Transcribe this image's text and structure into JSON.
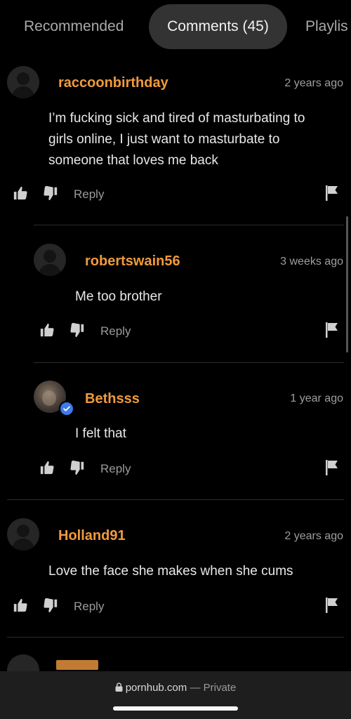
{
  "tabs": [
    {
      "label": "Recommended",
      "active": false
    },
    {
      "label": "Comments (45)",
      "active": true
    },
    {
      "label": "Playlis",
      "active": false
    }
  ],
  "actions": {
    "reply_label": "Reply"
  },
  "comments": [
    {
      "username": "raccoonbirthday",
      "time": "2 years ago",
      "body": "I’m fucking sick and tired of masturbating to girls online, I just want to masturbate to someone that loves me back",
      "avatar": "default-avatar-icon",
      "verified": false
    },
    {
      "username": "robertswain56",
      "time": "3 weeks ago",
      "body": "Me too brother",
      "avatar": "default-avatar-icon",
      "verified": false
    },
    {
      "username": "Bethsss",
      "time": "1 year ago",
      "body": "I felt that",
      "avatar": "profile-photo",
      "verified": true
    },
    {
      "username": "Holland91",
      "time": "2 years ago",
      "body": "Love the face she makes when she cums",
      "avatar": "default-avatar-icon",
      "verified": false
    }
  ],
  "browser": {
    "domain": "pornhub.com",
    "separator": "—",
    "mode": "Private"
  },
  "colors": {
    "background": "#000000",
    "username": "#f19a3e",
    "verified_badge": "#3b7bea",
    "active_tab": "#333333"
  }
}
